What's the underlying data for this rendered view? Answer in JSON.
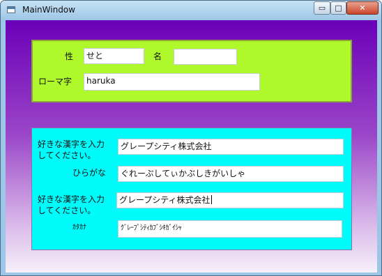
{
  "window": {
    "title": "MainWindow",
    "minimize_glyph": "▭",
    "maximize_glyph": "□",
    "close_glyph": "✕"
  },
  "name_form": {
    "last_name_label": "性",
    "last_name_value": "せと",
    "first_name_label": "名",
    "first_name_value": "",
    "romaji_label": "ローマ字",
    "romaji_value": "haruka"
  },
  "conversion_form": {
    "kanji_prompt_1_line1": "好きな漢字を入力",
    "kanji_prompt_1_line2": "してください。",
    "kanji_input_1": "グレープシティ株式会社",
    "hiragana_label": "ひらがな",
    "hiragana_value": "ぐれーぷしてぃかぶしきがいしゃ",
    "kanji_prompt_2_line1": "好きな漢字を入力",
    "kanji_prompt_2_line2": "してください。",
    "kanji_input_2": "グレープシティ株式会社",
    "katakana_label": "ｶﾀｶﾅ",
    "katakana_value": "ｸﾞﾚｰﾌﾟｼﾃｨｶﾌﾞｼｷｶﾞｲｼｬ"
  },
  "colors": {
    "panel_top": "#aef82c",
    "panel_bottom": "#00fbfb",
    "background_top": "#6a00b8",
    "background_bottom": "#f6f0fa"
  }
}
